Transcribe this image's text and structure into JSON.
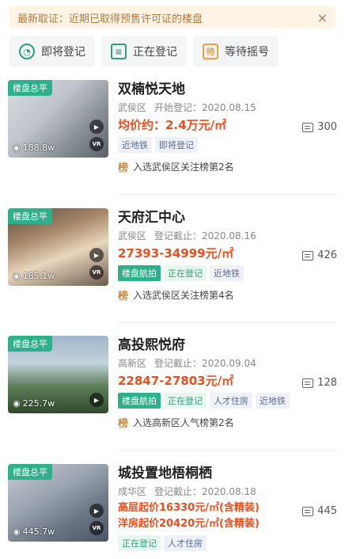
{
  "notice": {
    "text": "最新取证：近期已取得预售许可证的楼盘",
    "close": "×"
  },
  "filters": [
    {
      "label": "即将登记",
      "icon": "clock-icon",
      "glyph": ""
    },
    {
      "label": "正在登记",
      "icon": "document-icon",
      "glyph": ""
    },
    {
      "label": "等待摇号",
      "icon": "wait-icon",
      "glyph": "待"
    }
  ],
  "listings": [
    {
      "tag": "楼盘总平",
      "views": "188.8w",
      "vr": "VR",
      "title": "双楠悦天地",
      "district": "武侯区",
      "date_label": "开始登记：2020.08.15",
      "price_lines": [
        "均价约：2.4万元/㎡"
      ],
      "badges": [
        "近地铁",
        "即将登记"
      ],
      "rank_icon": "榜",
      "rank": "入选武侯区关注榜第2名",
      "comments": "300"
    },
    {
      "tag": "楼盘总平",
      "views": "185.1w",
      "vr": "VR",
      "title": "天府汇中心",
      "district": "武侯区",
      "date_label": "登记截止：2020.08.16",
      "price_lines": [
        "27393-34999元/㎡"
      ],
      "badges": [
        "楼盘航拍",
        "正在登记",
        "近地铁"
      ],
      "rank_icon": "榜",
      "rank": "入选武侯区关注榜第4名",
      "comments": "426"
    },
    {
      "tag": "楼盘总平",
      "views": "225.7w",
      "vr": "",
      "title": "高投熙悦府",
      "district": "高新区",
      "date_label": "登记截止：2020.09.04",
      "price_lines": [
        "22847-27803元/㎡"
      ],
      "badges": [
        "楼盘航拍",
        "正在登记",
        "人才住房",
        "近地铁"
      ],
      "rank_icon": "榜",
      "rank": "入选高新区人气榜第2名",
      "comments": "128"
    },
    {
      "tag": "楼盘总平",
      "views": "445.7w",
      "vr": "VR",
      "title": "城投置地梧桐栖",
      "district": "成华区",
      "date_label": "登记截止：2020.08.18",
      "price_lines": [
        "高层起价16330元/㎡(含精装)",
        "洋房起价20420元/㎡(含精装)"
      ],
      "badges": [
        "正在登记",
        "人才住房"
      ],
      "rank_icon": "",
      "rank": "",
      "comments": "445"
    }
  ]
}
